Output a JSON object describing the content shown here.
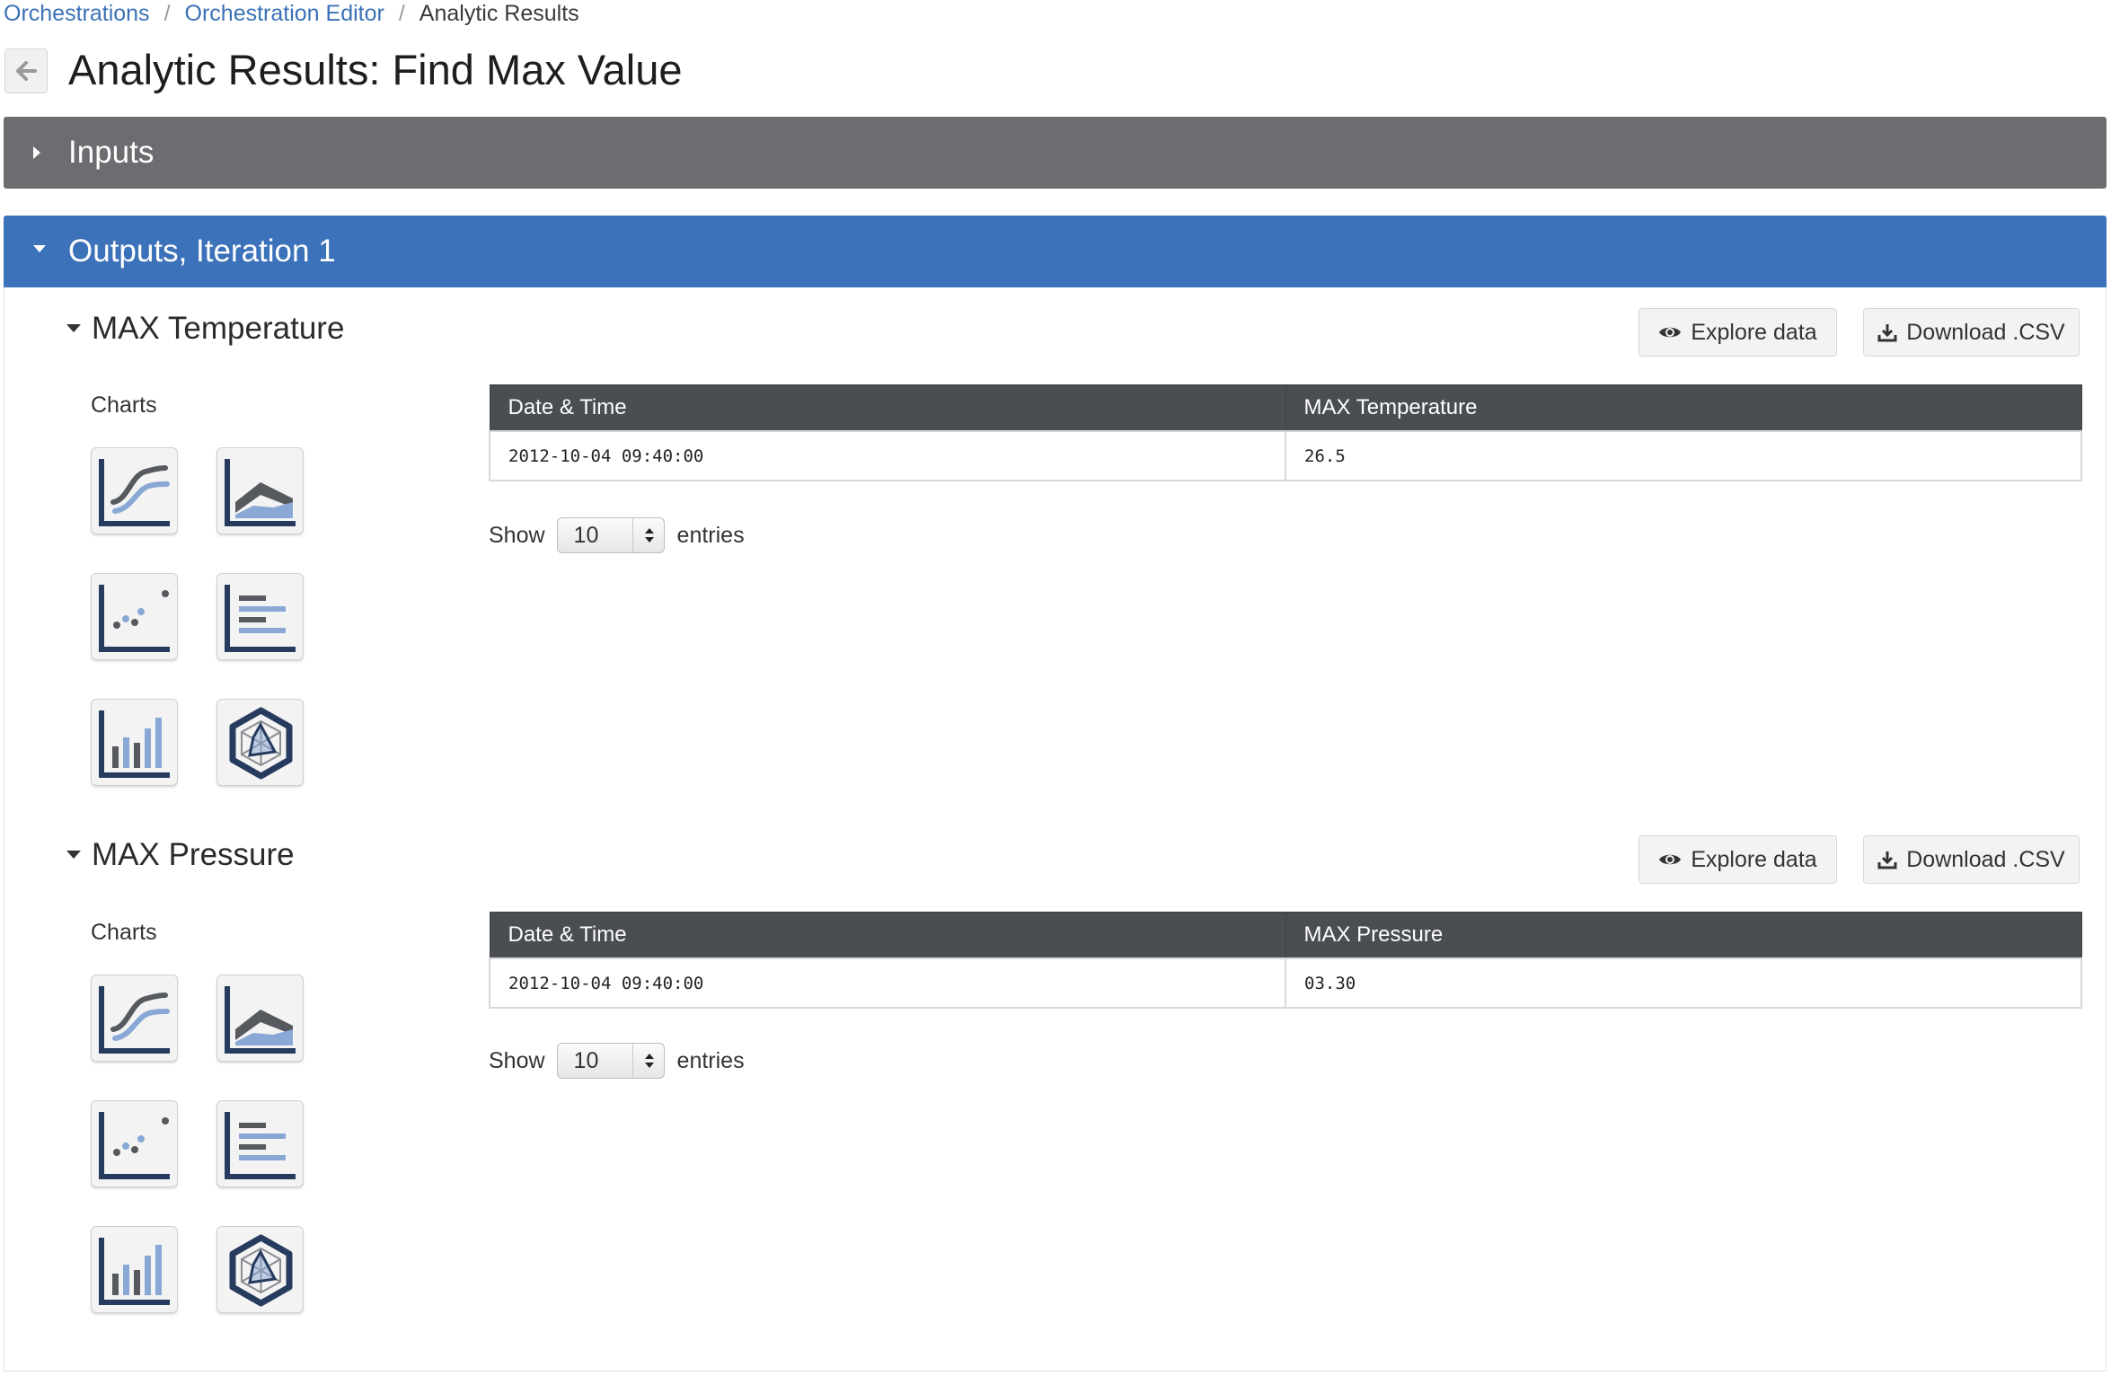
{
  "breadcrumb": {
    "items": [
      "Orchestrations",
      "Orchestration Editor"
    ],
    "current": "Analytic Results",
    "separator": "/"
  },
  "page": {
    "title": "Analytic Results: Find Max Value"
  },
  "panels": {
    "inputs_label": "Inputs",
    "outputs_label": "Outputs, Iteration 1"
  },
  "sections": [
    {
      "title": "MAX Temperature",
      "charts_label": "Charts",
      "explore_label": "Explore data",
      "download_label": "Download .CSV",
      "columns": [
        "Date & Time",
        "MAX Temperature"
      ],
      "rows": [
        [
          "2012-10-04 09:40:00",
          "26.5"
        ]
      ],
      "show_label": "Show",
      "page_size": "10",
      "entries_label": "entries"
    },
    {
      "title": "MAX Pressure",
      "charts_label": "Charts",
      "explore_label": "Explore data",
      "download_label": "Download .CSV",
      "columns": [
        "Date & Time",
        "MAX Pressure"
      ],
      "rows": [
        [
          "2012-10-04 09:40:00",
          "03.30"
        ]
      ],
      "show_label": "Show",
      "page_size": "10",
      "entries_label": "entries"
    }
  ],
  "colors": {
    "link": "#3a72b6",
    "inputs_bar": "#6b6d70",
    "outputs_bar": "#3b72b9",
    "table_header": "#4a4d52",
    "chart_dark": "#263b5e",
    "chart_light": "#8aa8d6"
  },
  "icons": {
    "back": "arrow-left-icon",
    "collapsed": "caret-right-icon",
    "expanded": "caret-down-icon",
    "explore": "eye-icon",
    "download": "download-icon",
    "chart_types": [
      "line-chart-icon",
      "area-chart-icon",
      "scatter-chart-icon",
      "horizontal-bar-chart-icon",
      "bar-chart-icon",
      "radar-chart-icon"
    ]
  }
}
